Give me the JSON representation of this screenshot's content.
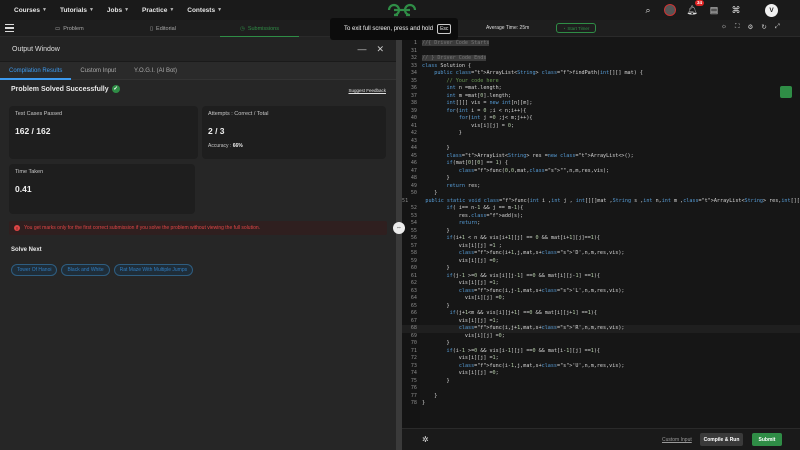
{
  "nav": {
    "items": [
      {
        "label": "Courses"
      },
      {
        "label": "Tutorials"
      },
      {
        "label": "Jobs"
      },
      {
        "label": "Practice"
      },
      {
        "label": "Contests"
      }
    ],
    "notification_count": "34",
    "avatar_letter": "V"
  },
  "tabs": {
    "problem": "Problem",
    "editorial": "Editorial",
    "submissions": "Submissions"
  },
  "fullscreen_toast": {
    "text": "To exit full screen, press and hold",
    "key": "Esc"
  },
  "average_time": "Average Time: 25m",
  "start_timer": "Start Timer",
  "output_window": {
    "title": "Output Window",
    "tabs": [
      "Compilation Results",
      "Custom Input",
      "Y.O.G.I. (AI Bot)"
    ],
    "status": "Problem Solved Successfully",
    "suggest_feedback": "Suggest Feedback",
    "test_cases_label": "Test Cases Passed",
    "test_cases_value": "162 / 162",
    "attempts_label": "Attempts : Correct / Total",
    "attempts_value": "2 / 3",
    "accuracy_label": "Accuracy :",
    "accuracy_value": "66%",
    "time_label": "Time Taken",
    "time_value": "0.41",
    "warning": "You get marks only for the first correct submission if you solve the problem without viewing the full solution.",
    "solve_next_title": "Solve Next",
    "solve_next": [
      "Tower Of Hanoi",
      "Black and White",
      "Rat Maze With Multiple Jumps"
    ]
  },
  "editor": {
    "footer": {
      "custom_input": "Custom Input",
      "compile_run": "Compile & Run",
      "submit": "Submit"
    },
    "lines": [
      {
        "n": "1",
        "code": "//{ Driver Code Starts"
      },
      {
        "n": "31",
        "code": ""
      },
      {
        "n": "32",
        "code": "// } Driver Code Ends"
      },
      {
        "n": "33",
        "code": "class Solution {"
      },
      {
        "n": "34",
        "code": "    public ArrayList<String> findPath(int[][] mat) {"
      },
      {
        "n": "35",
        "code": "        // Your code here"
      },
      {
        "n": "36",
        "code": "        int n =mat.length;"
      },
      {
        "n": "37",
        "code": "        int m =mat[0].length;"
      },
      {
        "n": "38",
        "code": "        int[][] vis = new int[n][m];"
      },
      {
        "n": "39",
        "code": "        for(int i = 0 ;i < n;i++){"
      },
      {
        "n": "40",
        "code": "            for(int j =0 ;j< m;j++){"
      },
      {
        "n": "41",
        "code": "                vis[i][j] = 0;"
      },
      {
        "n": "42",
        "code": "            }"
      },
      {
        "n": "43",
        "code": ""
      },
      {
        "n": "44",
        "code": "        }"
      },
      {
        "n": "45",
        "code": "        ArrayList<String> res =new ArrayList<>();"
      },
      {
        "n": "46",
        "code": "        if(mat[0][0] == 1) {"
      },
      {
        "n": "47",
        "code": "            func(0,0,mat,\"\",n,m,res,vis);"
      },
      {
        "n": "48",
        "code": "        }"
      },
      {
        "n": "49",
        "code": "        return res;"
      },
      {
        "n": "50",
        "code": "    }"
      },
      {
        "n": "51",
        "code": "    public static void func(int i ,int j , int[][]mat ,String s ,int n,int m ,ArrayList<String> res,int[][]vis){"
      },
      {
        "n": "52",
        "code": "        if( i== n-1 && j == m-1){"
      },
      {
        "n": "53",
        "code": "            res.add(s);"
      },
      {
        "n": "54",
        "code": "            return;"
      },
      {
        "n": "55",
        "code": "        }"
      },
      {
        "n": "56",
        "code": "        if(i+1 < n && vis[i+1][j] == 0 && mat[i+1][j]==1){"
      },
      {
        "n": "57",
        "code": "            vis[i][j] =1 ;"
      },
      {
        "n": "58",
        "code": "            func(i+1,j,mat,s+'D',n,m,res,vis);"
      },
      {
        "n": "59",
        "code": "            vis[i][j] =0;"
      },
      {
        "n": "60",
        "code": "        }"
      },
      {
        "n": "61",
        "code": "        if(j-1 >=0 && vis[i][j-1] ==0 && mat[i][j-1] ==1){"
      },
      {
        "n": "62",
        "code": "            vis[i][j] =1;"
      },
      {
        "n": "63",
        "code": "            func(i,j-1,mat,s+'L',n,m,res,vis);"
      },
      {
        "n": "64",
        "code": "              vis[i][j] =0;"
      },
      {
        "n": "65",
        "code": "        }"
      },
      {
        "n": "66",
        "code": "         if(j+1<m && vis[i][j+1] ==0 && mat[i][j+1] ==1){"
      },
      {
        "n": "67",
        "code": "            vis[i][j] =1;"
      },
      {
        "n": "68",
        "code": "            func(i,j+1,mat,s+'R',n,m,res,vis);"
      },
      {
        "n": "69",
        "code": "              vis[i][j] =0;"
      },
      {
        "n": "70",
        "code": "        }"
      },
      {
        "n": "71",
        "code": "        if(i-1 >=0 && vis[i-1][j] ==0 && mat[i-1][j] ==1){"
      },
      {
        "n": "72",
        "code": "            vis[i][j] =1;"
      },
      {
        "n": "73",
        "code": "            func(i-1,j,mat,s+'U',n,m,res,vis);"
      },
      {
        "n": "74",
        "code": "            vis[i][j] =0;"
      },
      {
        "n": "75",
        "code": "        }"
      },
      {
        "n": "76",
        "code": ""
      },
      {
        "n": "77",
        "code": "    }"
      },
      {
        "n": "78",
        "code": "}"
      }
    ]
  },
  "colors": {
    "accent_green": "#2f8d46",
    "link_blue": "#3d9bf0",
    "error_red": "#e04545"
  }
}
